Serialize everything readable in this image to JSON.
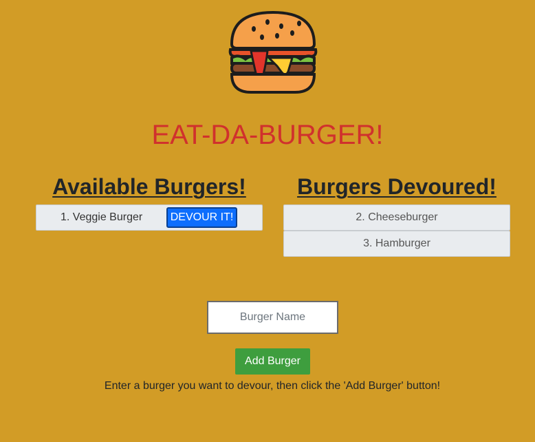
{
  "logo": {
    "icon": "burger-icon"
  },
  "title": "EAT-DA-BURGER!",
  "available": {
    "heading": "Available Burgers!",
    "items": [
      {
        "label": "1. Veggie Burger",
        "button": "DEVOUR IT!"
      }
    ]
  },
  "devoured": {
    "heading": "Burgers Devoured!",
    "items": [
      {
        "label": "2. Cheeseburger"
      },
      {
        "label": "3. Hamburger"
      }
    ]
  },
  "form": {
    "placeholder": "Burger Name",
    "value": "",
    "button": "Add Burger"
  },
  "instructions": "Enter a burger you want to devour, then click the 'Add Burger' button!",
  "colors": {
    "background": "#d29c26",
    "title": "#d0312d",
    "devour_button": "#0d6efd",
    "add_button": "#3e9e3e"
  }
}
